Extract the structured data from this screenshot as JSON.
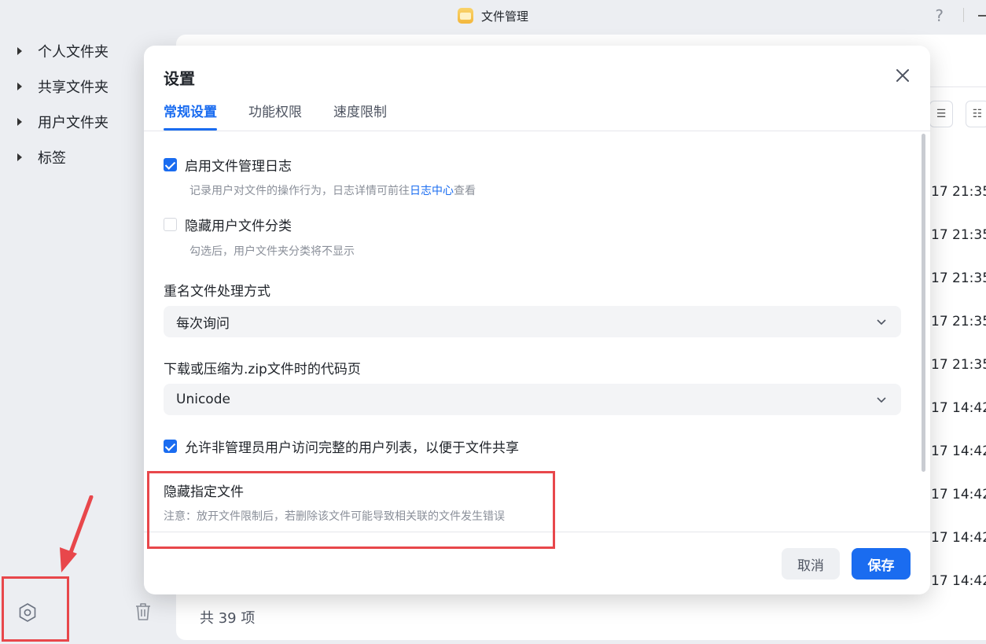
{
  "window": {
    "title": "文件管理",
    "help": "?"
  },
  "sidebar": {
    "items": [
      {
        "label": "个人文件夹"
      },
      {
        "label": "共享文件夹"
      },
      {
        "label": "用户文件夹"
      },
      {
        "label": "标签"
      }
    ]
  },
  "main": {
    "times": [
      "17 21:35",
      "17 21:35",
      "17 21:35",
      "17 21:35",
      "17 21:35",
      "17 14:42",
      "17 14:42",
      "17 14:42",
      "17 14:42",
      "17 14:42"
    ],
    "count": "共 39 项"
  },
  "dialog": {
    "title": "设置",
    "tabs": [
      {
        "label": "常规设置",
        "active": true
      },
      {
        "label": "功能权限",
        "active": false
      },
      {
        "label": "速度限制",
        "active": false
      }
    ],
    "enable_log": {
      "label": "启用文件管理日志",
      "checked": true,
      "hint_before": "记录用户对文件的操作行为，日志详情可前往",
      "hint_link": "日志中心",
      "hint_after": "查看"
    },
    "hide_user_category": {
      "label": "隐藏用户文件分类",
      "checked": false,
      "hint": "勾选后，用户文件夹分类将不显示"
    },
    "rename_mode": {
      "label": "重名文件处理方式",
      "value": "每次询问"
    },
    "zip_codepage": {
      "label": "下载或压缩为.zip文件时的代码页",
      "value": "Unicode"
    },
    "allow_user_list": {
      "label": "允许非管理员用户访问完整的用户列表，以便于文件共享",
      "checked": true
    },
    "hide_files": {
      "label": "隐藏指定文件",
      "hint": "注意：放开文件限制后，若删除该文件可能导致相关联的文件发生错误"
    },
    "cancel_label": "取消",
    "save_label": "保存"
  },
  "colors": {
    "accent": "#1a6cf0",
    "highlight": "#e8474b"
  }
}
